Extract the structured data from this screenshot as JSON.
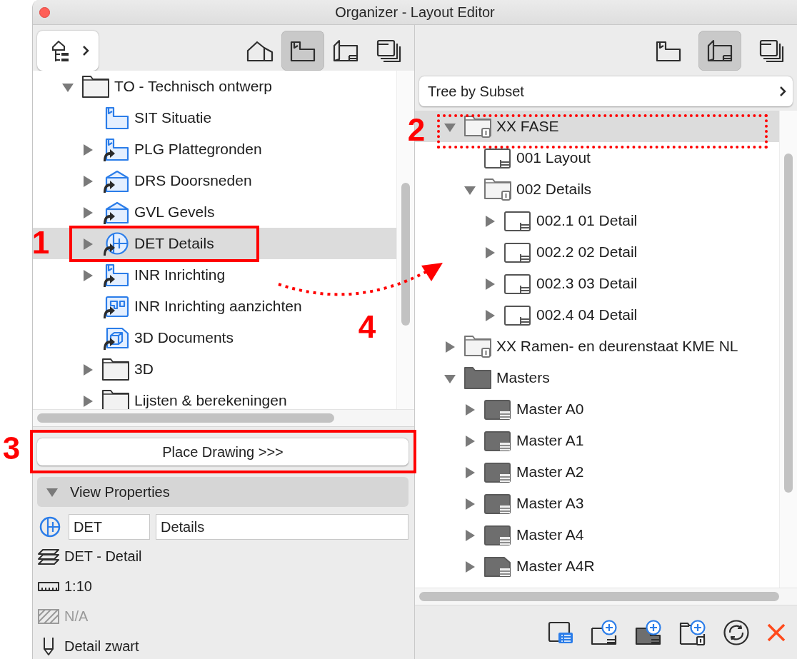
{
  "window": {
    "title": "Organizer - Layout Editor"
  },
  "left_panel": {
    "toolbar": [
      {
        "kind": "model",
        "selected": false
      },
      {
        "kind": "views",
        "selected": true
      },
      {
        "kind": "layouts",
        "selected": false
      },
      {
        "kind": "publisher",
        "selected": false
      }
    ],
    "tree": [
      {
        "label": "TO - Technisch ontwerp",
        "kind": "folder",
        "expanded": true,
        "selected": false,
        "children": [
          {
            "label": "SIT Situatie",
            "kind": "plan",
            "shortcut": false,
            "selected": false
          },
          {
            "label": "PLG Plattegronden",
            "kind": "plan",
            "shortcut": true,
            "expanded": false,
            "selected": false
          },
          {
            "label": "DRS Doorsneden",
            "kind": "section",
            "shortcut": true,
            "expanded": false,
            "selected": false
          },
          {
            "label": "GVL Gevels",
            "kind": "elevation",
            "shortcut": true,
            "expanded": false,
            "selected": false
          },
          {
            "label": "DET Details",
            "kind": "detail",
            "shortcut": true,
            "expanded": false,
            "selected": true
          },
          {
            "label": "INR Inrichting",
            "kind": "plan",
            "shortcut": true,
            "expanded": false,
            "selected": false
          },
          {
            "label": "INR Inrichting aanzichten",
            "kind": "interior",
            "shortcut": true,
            "selected": false
          },
          {
            "label": "3D Documents",
            "kind": "document-3d",
            "shortcut": true,
            "selected": false
          },
          {
            "label": "3D",
            "kind": "folder",
            "expanded": false,
            "selected": false
          },
          {
            "label": "Lijsten & berekeningen",
            "kind": "folder",
            "expanded": false,
            "selected": false
          }
        ]
      }
    ],
    "place_button": "Place Drawing >>>",
    "view_properties": {
      "title": "View Properties",
      "expanded": true,
      "id_value": "DET",
      "name_value": "Details",
      "rows": [
        {
          "kind": "layer",
          "text": "DET - Detail",
          "disabled": false
        },
        {
          "kind": "scale",
          "text": "1:10",
          "disabled": false
        },
        {
          "kind": "hatch",
          "text": "N/A",
          "disabled": true
        },
        {
          "kind": "pen",
          "text": "Detail zwart",
          "disabled": false
        }
      ]
    }
  },
  "right_panel": {
    "toolbar": [
      {
        "kind": "views",
        "selected": false
      },
      {
        "kind": "layouts",
        "selected": true
      },
      {
        "kind": "publisher",
        "selected": false
      }
    ],
    "tree_mode": "Tree by Subset",
    "tree": [
      {
        "label": "XX FASE",
        "kind": "subset",
        "expanded": true,
        "selected": true,
        "children": [
          {
            "label": "001 Layout",
            "kind": "layout",
            "selected": false
          },
          {
            "label": "002 Details",
            "kind": "subset",
            "expanded": true,
            "selected": false,
            "children": [
              {
                "label": "002.1 01 Detail",
                "kind": "layout",
                "expanded": false,
                "selected": false
              },
              {
                "label": "002.2 02 Detail",
                "kind": "layout",
                "expanded": false,
                "selected": false
              },
              {
                "label": "002.3 03 Detail",
                "kind": "layout",
                "expanded": false,
                "selected": false
              },
              {
                "label": "002.4 04 Detail",
                "kind": "layout",
                "expanded": false,
                "selected": false
              }
            ]
          }
        ]
      },
      {
        "label": "XX Ramen- en deurenstaat KME NL",
        "kind": "subset",
        "expanded": false,
        "selected": false
      },
      {
        "label": "Masters",
        "kind": "master-folder",
        "expanded": true,
        "selected": false,
        "children": [
          {
            "label": "Master A0",
            "kind": "master",
            "expanded": false,
            "selected": false
          },
          {
            "label": "Master A1",
            "kind": "master",
            "expanded": false,
            "selected": false
          },
          {
            "label": "Master A2",
            "kind": "master",
            "expanded": false,
            "selected": false
          },
          {
            "label": "Master A3",
            "kind": "master",
            "expanded": false,
            "selected": false
          },
          {
            "label": "Master A4",
            "kind": "master",
            "expanded": false,
            "selected": false
          },
          {
            "label": "Master A4R",
            "kind": "master-portrait",
            "expanded": false,
            "selected": false
          }
        ]
      }
    ]
  },
  "annotations": [
    {
      "label": "1"
    },
    {
      "label": "2"
    },
    {
      "label": "3"
    },
    {
      "label": "4"
    }
  ]
}
